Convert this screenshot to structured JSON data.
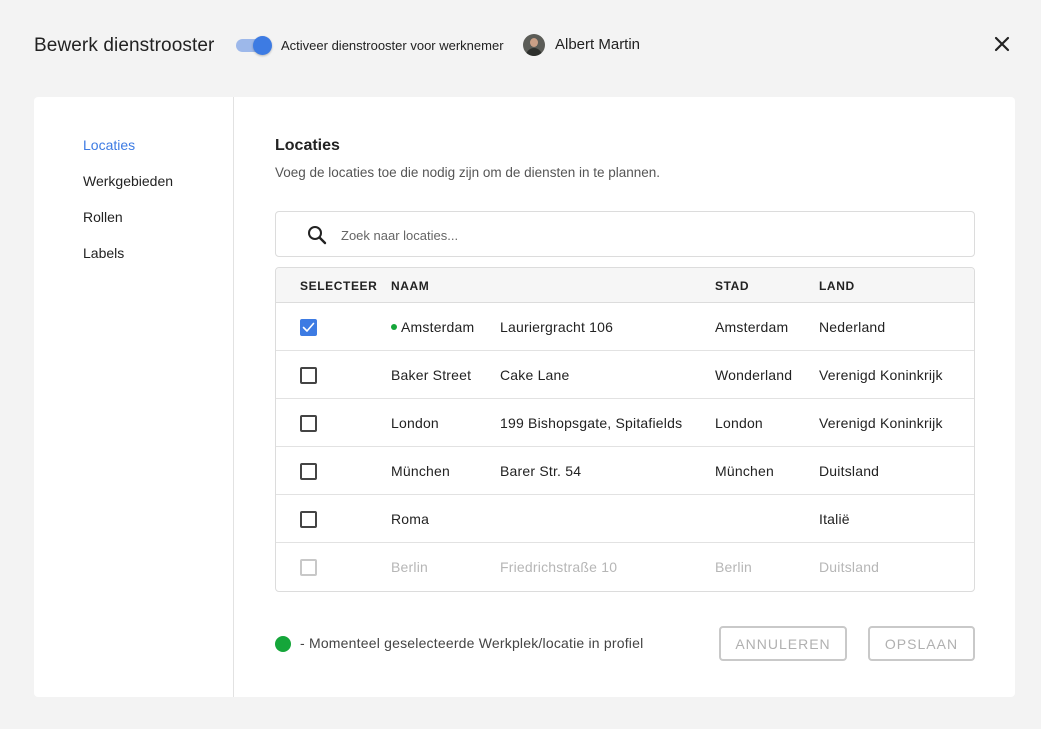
{
  "header": {
    "title": "Bewerk dienstrooster",
    "toggle_label": "Activeer dienstrooster voor werknemer",
    "toggle_on": true,
    "user_name": "Albert Martin"
  },
  "sidebar": {
    "items": [
      {
        "label": "Locaties",
        "active": true
      },
      {
        "label": "Werkgebieden",
        "active": false
      },
      {
        "label": "Rollen",
        "active": false
      },
      {
        "label": "Labels",
        "active": false
      }
    ]
  },
  "main": {
    "title": "Locaties",
    "subtitle": "Voeg de locaties toe die nodig zijn om de diensten in te plannen.",
    "search": {
      "placeholder": "Zoek naar locaties..."
    },
    "table": {
      "headers": {
        "select": "SELECTEER",
        "name": "NAAM",
        "city": "STAD",
        "country": "LAND"
      },
      "rows": [
        {
          "name": "Amsterdam",
          "address": "Lauriergracht 106",
          "city": "Amsterdam",
          "country": "Nederland",
          "checked": true,
          "current": true,
          "disabled": false
        },
        {
          "name": "Baker Street",
          "address": "Cake Lane",
          "city": "Wonderland",
          "country": "Verenigd Koninkrijk",
          "checked": false,
          "current": false,
          "disabled": false
        },
        {
          "name": "London",
          "address": "199 Bishopsgate, Spitafields",
          "city": "London",
          "country": "Verenigd Koninkrijk",
          "checked": false,
          "current": false,
          "disabled": false
        },
        {
          "name": "München",
          "address": "Barer Str. 54",
          "city": "München",
          "country": "Duitsland",
          "checked": false,
          "current": false,
          "disabled": false
        },
        {
          "name": "Roma",
          "address": "",
          "city": "",
          "country": "Italië",
          "checked": false,
          "current": false,
          "disabled": false
        },
        {
          "name": "Berlin",
          "address": "Friedrichstraße 10",
          "city": "Berlin",
          "country": "Duitsland",
          "checked": false,
          "current": false,
          "disabled": true
        }
      ]
    },
    "legend": "- Momenteel geselecteerde Werkplek/locatie in profiel",
    "buttons": {
      "cancel": "ANNULEREN",
      "save": "OPSLAAN"
    }
  },
  "colors": {
    "accent": "#3d7be3",
    "current_location": "#15a63a",
    "background": "#f3f3f3"
  },
  "icons": [
    "close-icon",
    "search-icon",
    "checkmark-icon"
  ]
}
